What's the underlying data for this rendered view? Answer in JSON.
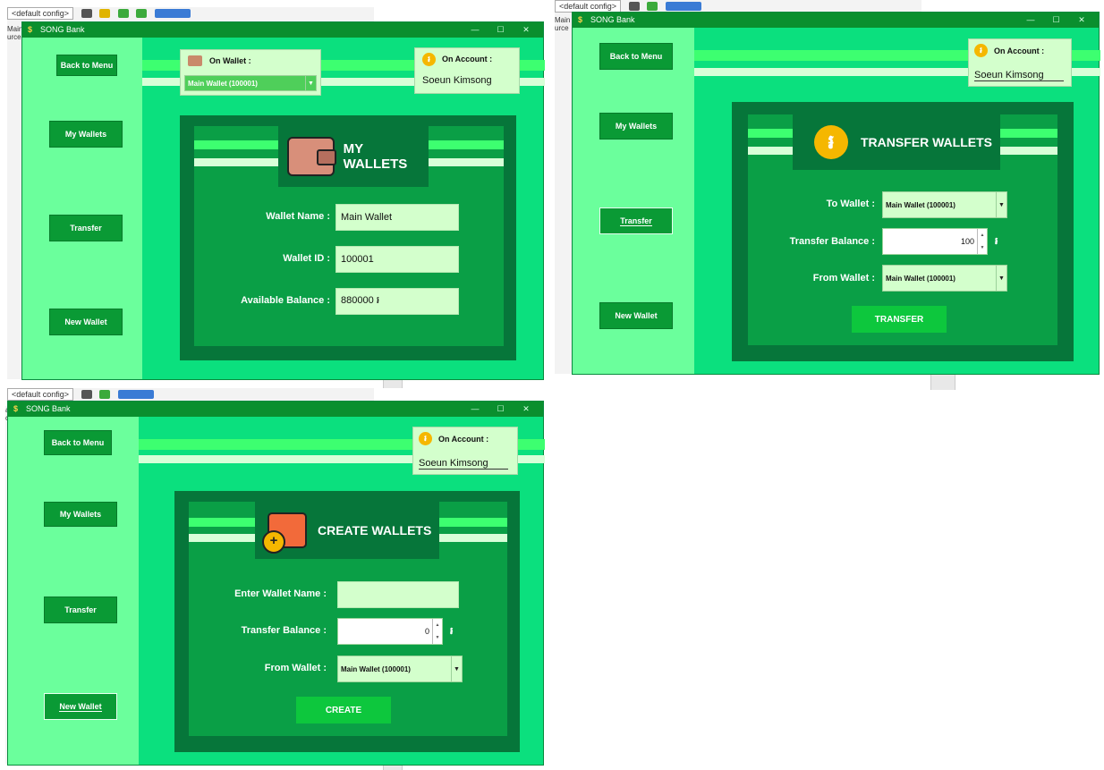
{
  "app_title": "SONG Bank",
  "window_controls": {
    "minimize": "—",
    "maximize": "☐",
    "close": "✕"
  },
  "ide": {
    "config_combo": "<default config>",
    "main_label": "Main",
    "source_label": "urce",
    "main_label_short": "ain",
    "source_label_short": "ce"
  },
  "sidebar": {
    "back": "Back to Menu",
    "my_wallets": "My Wallets",
    "transfer": "Transfer",
    "new_wallet": "New Wallet"
  },
  "account": {
    "label": "On Account :",
    "name": "Soeun Kimsong"
  },
  "currency_symbol": "៛",
  "screens": {
    "my_wallets": {
      "on_wallet_label": "On Wallet :",
      "on_wallet_value": "Main Wallet (100001)",
      "header": "MY WALLETS",
      "fields": [
        {
          "label": "Wallet Name   :",
          "value": "Main Wallet"
        },
        {
          "label": "Wallet ID   :",
          "value": "100001"
        },
        {
          "label": "Available Balance   :",
          "value": "880000 ៛"
        }
      ]
    },
    "transfer": {
      "header": "TRANSFER WALLETS",
      "to_label": "To Wallet   :",
      "to_value": "Main Wallet (100001)",
      "balance_label": "Transfer Balance   :",
      "balance_value": "100",
      "from_label": "From Wallet   :",
      "from_value": "Main Wallet (100001)",
      "button": "TRANSFER"
    },
    "create": {
      "header": "CREATE WALLETS",
      "name_label": "Enter Wallet Name   :",
      "name_value": "",
      "balance_label": "Transfer Balance   :",
      "balance_value": "0",
      "from_label": "From Wallet   :",
      "from_value": "Main Wallet (100001)",
      "button": "CREATE"
    }
  },
  "colors": {
    "title_bar": "#0a8f2e",
    "window_bg": "#0be07e",
    "sidebar": "#6bff9c",
    "panel_dark": "#06763a",
    "panel": "#0a9f46",
    "field_bg": "#d3ffcc",
    "button": "#0dc73d"
  }
}
